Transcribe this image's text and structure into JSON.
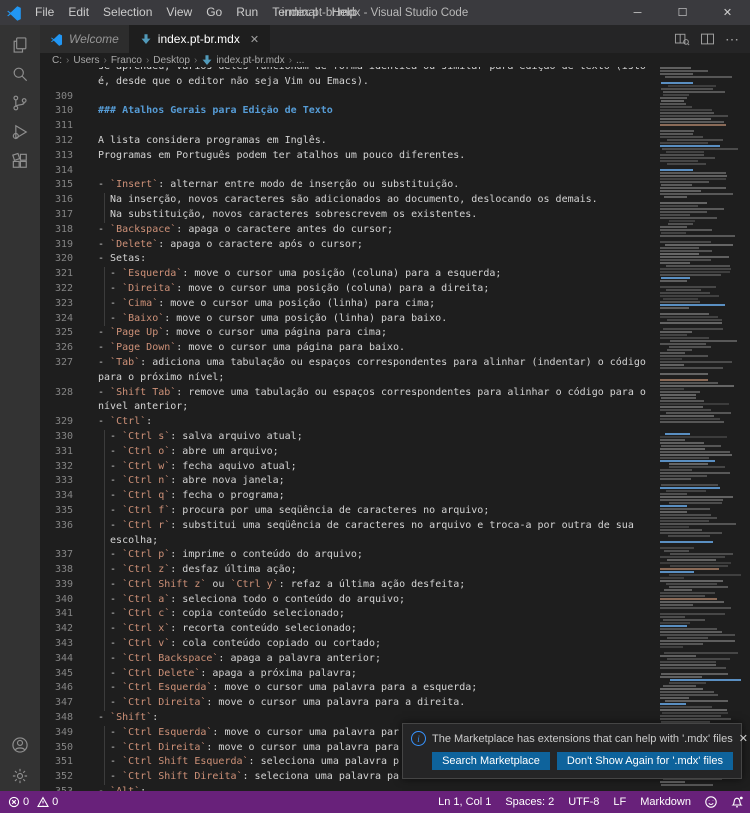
{
  "window": {
    "title": "index.pt-br.mdx - Visual Studio Code",
    "controls": [
      {
        "name": "minimize",
        "glyph": "─"
      },
      {
        "name": "maximize",
        "glyph": "☐"
      },
      {
        "name": "close",
        "glyph": "✕"
      }
    ]
  },
  "menu_bar": [
    "File",
    "Edit",
    "Selection",
    "View",
    "Go",
    "Run",
    "Terminal",
    "Help"
  ],
  "activity_bar": {
    "top": [
      "explorer",
      "search",
      "source-control",
      "run-debug",
      "extensions"
    ],
    "bottom": [
      "account",
      "settings"
    ]
  },
  "tab_bar": {
    "tabs": [
      {
        "label": "Welcome",
        "icon": "vscode-logo",
        "active": false
      },
      {
        "label": "index.pt-br.mdx",
        "icon": "mdx-file",
        "active": true,
        "close_glyph": "✕"
      }
    ],
    "actions": [
      "open-preview",
      "split-editor",
      "more-actions"
    ]
  },
  "breadcrumbs": {
    "separator": "›",
    "items": [
      {
        "label": "C:"
      },
      {
        "label": "Users"
      },
      {
        "label": "Franco"
      },
      {
        "label": "Desktop"
      },
      {
        "label": "index.pt-br.mdx",
        "icon": "mdx-file"
      },
      {
        "label": "..."
      }
    ]
  },
  "editor": {
    "rows": [
      [
        "",
        "se aprendeu, vários deles funcionam de forma idêntica ou similar para edição de texto (isto"
      ],
      [
        "",
        "é, desde que o editor não seja Vim ou Emacs)."
      ],
      [
        "309",
        ""
      ],
      [
        "310",
        "### Atalhos Gerais para Edição de Texto"
      ],
      [
        "311",
        ""
      ],
      [
        "312",
        "A lista considera programas em Inglês."
      ],
      [
        "313",
        "Programas em Português podem ter atalhos um pouco diferentes."
      ],
      [
        "314",
        ""
      ],
      [
        "315",
        "- `Insert`: alternar entre modo de inserção ou substituição."
      ],
      [
        "316",
        "  Na inserção, novos caracteres são adicionados ao documento, deslocando os demais."
      ],
      [
        "317",
        "  Na substituição, novos caracteres sobrescrevem os existentes."
      ],
      [
        "318",
        "- `Backspace`: apaga o caractere antes do cursor;"
      ],
      [
        "319",
        "- `Delete`: apaga o caractere após o cursor;"
      ],
      [
        "320",
        "- Setas:"
      ],
      [
        "321",
        "  - `Esquerda`: move o cursor uma posição (coluna) para a esquerda;"
      ],
      [
        "322",
        "  - `Direita`: move o cursor uma posição (coluna) para a direita;"
      ],
      [
        "323",
        "  - `Cima`: move o cursor uma posição (linha) para cima;"
      ],
      [
        "324",
        "  - `Baixo`: move o cursor uma posição (linha) para baixo."
      ],
      [
        "325",
        "- `Page Up`: move o cursor uma página para cima;"
      ],
      [
        "326",
        "- `Page Down`: move o cursor uma página para baixo."
      ],
      [
        "327",
        "- `Tab`: adiciona uma tabulação ou espaços correspondentes para alinhar (indentar) o código"
      ],
      [
        "",
        "para o próximo nível;"
      ],
      [
        "328",
        "- `Shift Tab`: remove uma tabulação ou espaços correspondentes para alinhar o código para o"
      ],
      [
        "",
        "nível anterior;"
      ],
      [
        "329",
        "- `Ctrl`:"
      ],
      [
        "330",
        "  - `Ctrl s`: salva arquivo atual;"
      ],
      [
        "331",
        "  - `Ctrl o`: abre um arquivo;"
      ],
      [
        "332",
        "  - `Ctrl w`: fecha aquivo atual;"
      ],
      [
        "333",
        "  - `Ctrl n`: abre nova janela;"
      ],
      [
        "334",
        "  - `Ctrl q`: fecha o programa;"
      ],
      [
        "335",
        "  - `Ctrl f`: procura por uma seqüência de caracteres no arquivo;"
      ],
      [
        "336",
        "  - `Ctrl r`: substitui uma seqüência de caracteres no arquivo e troca-a por outra de sua"
      ],
      [
        "",
        "  escolha;"
      ],
      [
        "337",
        "  - `Ctrl p`: imprime o conteúdo do arquivo;"
      ],
      [
        "338",
        "  - `Ctrl z`: desfaz última ação;"
      ],
      [
        "339",
        "  - `Ctrl Shift z` ou `Ctrl y`: refaz a última ação desfeita;"
      ],
      [
        "340",
        "  - `Ctrl a`: seleciona todo o conteúdo do arquivo;"
      ],
      [
        "341",
        "  - `Ctrl c`: copia conteúdo selecionado;"
      ],
      [
        "342",
        "  - `Ctrl x`: recorta conteúdo selecionado;"
      ],
      [
        "343",
        "  - `Ctrl v`: cola conteúdo copiado ou cortado;"
      ],
      [
        "344",
        "  - `Ctrl Backspace`: apaga a palavra anterior;"
      ],
      [
        "345",
        "  - `Ctrl Delete`: apaga a próxima palavra;"
      ],
      [
        "346",
        "  - `Ctrl Esquerda`: move o cursor uma palavra para a esquerda;"
      ],
      [
        "347",
        "  - `Ctrl Direita`: move o cursor uma palavra para a direita."
      ],
      [
        "348",
        "- `Shift`:"
      ],
      [
        "349",
        "  - `Ctrl Esquerda`: move o cursor uma palavra par"
      ],
      [
        "350",
        "  - `Ctrl Direita`: move o cursor uma palavra para"
      ],
      [
        "351",
        "  - `Ctrl Shift Esquerda`: seleciona uma palavra p"
      ],
      [
        "352",
        "  - `Ctrl Shift Direita`: seleciona uma palavra pa"
      ],
      [
        "353",
        "- `Alt`:"
      ]
    ]
  },
  "notification": {
    "icon": "info",
    "message": "The Marketplace has extensions that can help with '.mdx' files",
    "close_glyph": "✕",
    "buttons": [
      "Search Marketplace",
      "Don't Show Again for '.mdx' files"
    ]
  },
  "status_bar": {
    "errors": "0",
    "warnings": "0",
    "right_items": [
      "Ln 1, Col 1",
      "Spaces: 2",
      "UTF-8",
      "LF",
      "Markdown"
    ],
    "right_icons": [
      "feedback",
      "bell"
    ]
  },
  "colors": {
    "status_bar": "#68217a",
    "button": "#0e639c",
    "inline_code": "#ce9178",
    "heading": "#569cd6",
    "info_icon": "#3794ff",
    "mdx_icon": "#519aba"
  }
}
